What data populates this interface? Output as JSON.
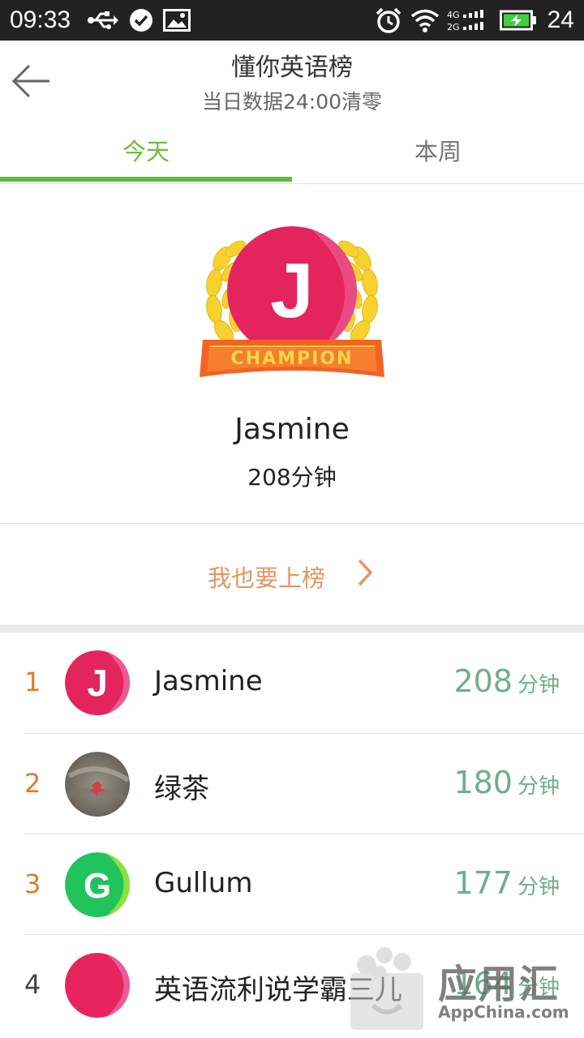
{
  "status_bar": {
    "time": "09:33",
    "battery": "24",
    "icons": [
      "usb-icon",
      "check-circle-icon",
      "image-icon",
      "alarm-icon",
      "wifi-icon",
      "signal-4g-2g-icon",
      "battery-icon"
    ]
  },
  "header": {
    "title": "懂你英语榜",
    "subtitle": "当日数据24:00清零",
    "back_icon": "back-arrow-icon"
  },
  "tabs": [
    {
      "label": "今天",
      "active": true
    },
    {
      "label": "本周",
      "active": false
    }
  ],
  "champion": {
    "badge_letter": "J",
    "ribbon_text": "CHAMPION",
    "name": "Jasmine",
    "score": "208分钟"
  },
  "join": {
    "label": "我也要上榜"
  },
  "leaderboard": [
    {
      "rank": "1",
      "name": "Jasmine",
      "score": "208",
      "unit": "分钟",
      "avatar": "J"
    },
    {
      "rank": "2",
      "name": "绿茶",
      "score": "180",
      "unit": "分钟",
      "avatar": "photo"
    },
    {
      "rank": "3",
      "name": "Gullum",
      "score": "177",
      "unit": "分钟",
      "avatar": "G"
    },
    {
      "rank": "4",
      "name": "英语流利说学霸三儿",
      "score": "164",
      "unit": "分钟",
      "avatar": ""
    }
  ],
  "watermark": {
    "text": "应用汇",
    "sub": "AppChina.com"
  },
  "colors": {
    "accent_green": "#5cbf30",
    "rank_orange": "#e07b2c",
    "score_green": "#6fae8d",
    "join_orange": "#e79463"
  }
}
